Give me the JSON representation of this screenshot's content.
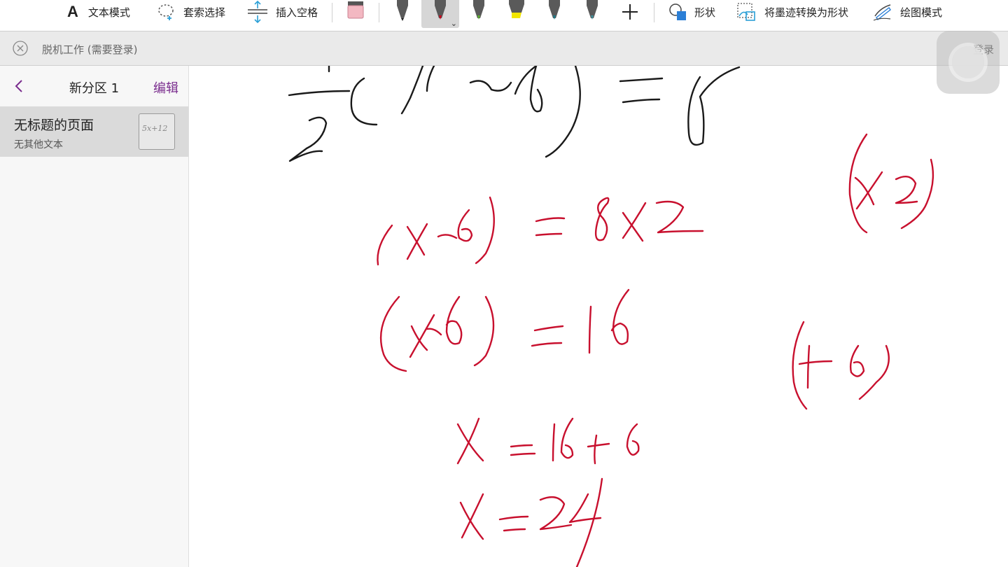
{
  "toolbar": {
    "text_mode": "文本模式",
    "lasso_select": "套索选择",
    "insert_space": "插入空格",
    "shapes": "形状",
    "ink_to_shape": "将墨迹转换为形状",
    "draw_mode": "绘图模式",
    "pens": [
      {
        "name": "black-pen",
        "color": "#222222"
      },
      {
        "name": "red-pen",
        "color": "#d0021b",
        "selected": true
      },
      {
        "name": "green-pen",
        "color": "#5db030"
      },
      {
        "name": "yellow-highlighter",
        "color": "#f2e600"
      },
      {
        "name": "teal-pen",
        "color": "#1c7a8a"
      },
      {
        "name": "teal-pen-2",
        "color": "#3f8f9a"
      }
    ]
  },
  "banner": {
    "message": "脱机工作 (需要登录)",
    "login": "登录"
  },
  "sidebar": {
    "section_title": "新分区 1",
    "edit": "编辑",
    "pages": [
      {
        "title": "无标题的页面",
        "preview": "无其他文本",
        "thumb_text": "5x+12"
      }
    ]
  },
  "colors": {
    "accent": "#7a2d8e",
    "ink_red": "#c8102e",
    "ink_black": "#1a1a1a"
  }
}
